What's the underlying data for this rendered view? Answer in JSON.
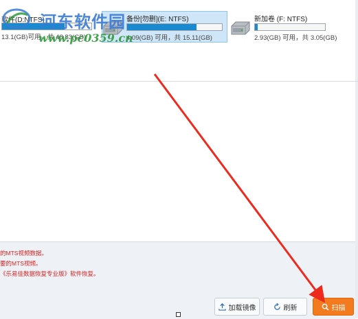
{
  "drives": [
    {
      "name": "软件(D:NTFS)",
      "capacity_text": "13.1(GB)可用，共 48.83(GB)",
      "used_fraction": 0.7
    },
    {
      "name": "备份[勿删](E: NTFS)",
      "capacity_text": "4.09(GB) 可用，共 15.11(GB)",
      "used_fraction": 0.73
    },
    {
      "name": "新加卷 (F: NTFS)",
      "capacity_text": "2.93(GB) 可用，共 3.05(GB)",
      "used_fraction": 0.04
    }
  ],
  "watermark": {
    "title": "河东软件园",
    "url": "www.pc0359.cn"
  },
  "notes": [
    "的MTS视频数据。",
    "要的MTS视频。",
    "《乐易佳数据恢复专业版》软件恢复。"
  ],
  "buttons": {
    "load_image": "加载镜像",
    "refresh": "刷新",
    "scan": "扫描"
  },
  "colors": {
    "accent": "#1a8ad0",
    "scan_button": "#f47a1f",
    "note_text": "#dd2222",
    "arrow": "#ee2a1e"
  }
}
